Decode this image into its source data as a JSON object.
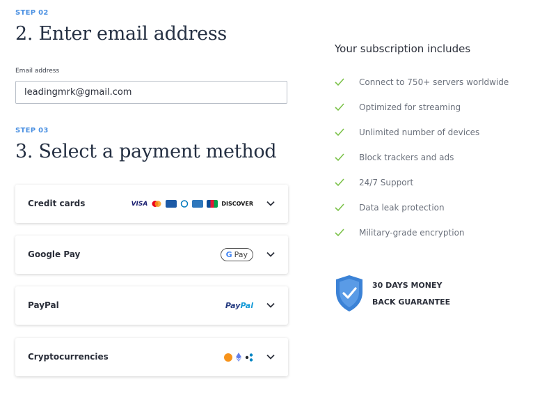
{
  "step2": {
    "label": "STEP 02",
    "heading": "2. Enter email address"
  },
  "email": {
    "label": "Email address",
    "value": "leadingmrk@gmail.com"
  },
  "step3": {
    "label": "STEP 03",
    "heading": "3. Select a payment method"
  },
  "payments": [
    {
      "label": "Credit cards",
      "logos": [
        "VISA",
        "mastercard",
        "maestro",
        "diners",
        "AMEX",
        "JCB",
        "DISCOVER"
      ]
    },
    {
      "label": "Google Pay",
      "logo_text": "Pay",
      "logo_g": "G"
    },
    {
      "label": "PayPal",
      "logo_p1": "Pay",
      "logo_p2": "Pal"
    },
    {
      "label": "Cryptocurrencies",
      "icons": [
        "bitcoin-icon",
        "ethereum-icon",
        "ripple-icon"
      ]
    }
  ],
  "subscription": {
    "title": "Your subscription includes",
    "features": [
      "Connect to 750+ servers worldwide",
      "Optimized for streaming",
      "Unlimited number of devices",
      "Block trackers and ads",
      "24/7 Support",
      "Data leak protection",
      "Military-grade encryption"
    ]
  },
  "guarantee": {
    "line1": "30 DAYS MONEY",
    "line2": "BACK GUARANTEE"
  },
  "colors": {
    "accent": "#4a90e2",
    "check": "#7cc24a",
    "shield": "#3b82d6",
    "heading": "#253043"
  }
}
